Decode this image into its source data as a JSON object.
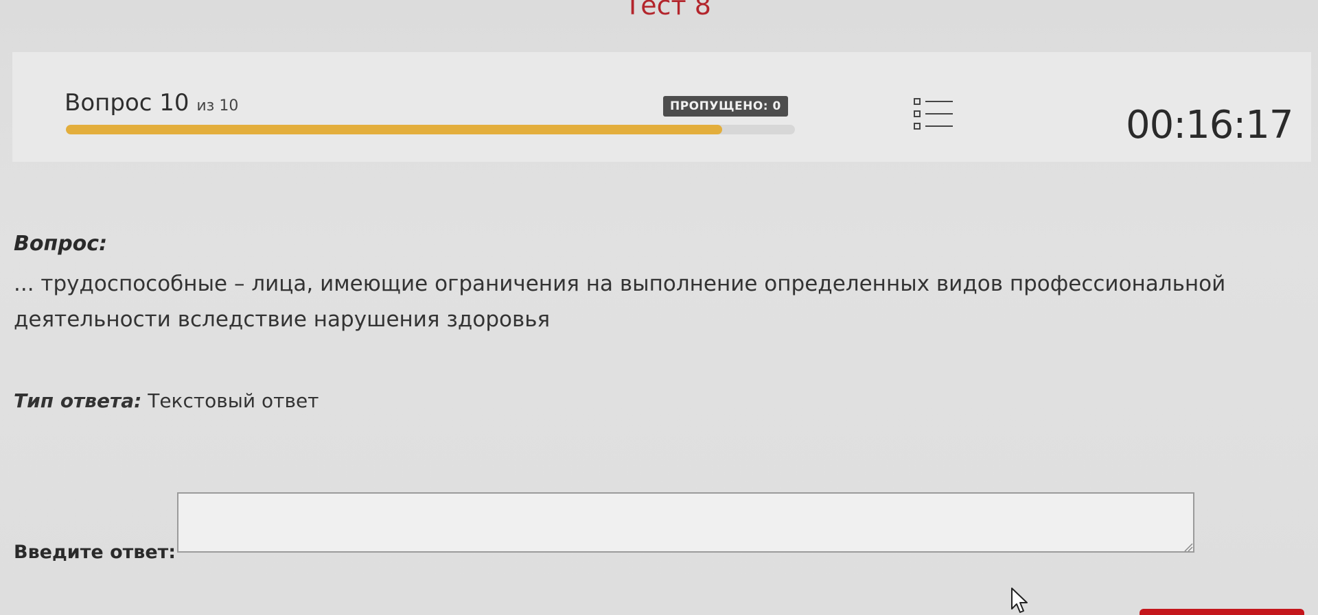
{
  "page": {
    "title": "Тест 8"
  },
  "header": {
    "question_word": "Вопрос",
    "current": "10",
    "of_text": "из 10",
    "progress_percent": 90,
    "skipped_label": "ПРОПУЩЕНО: 0",
    "list_icon": "list-icon",
    "timer": "00:16:17"
  },
  "question": {
    "label": "Вопрос:",
    "text": "... трудоспособные – лица, имеющие ограничения на выполнение определенных видов профессиональной деятельности вследствие нарушения здоровья"
  },
  "answer": {
    "type_label": "Тип ответа:",
    "type_value": "Текстовый ответ",
    "enter_label": "Введите ответ:",
    "value": ""
  },
  "colors": {
    "title_red": "#b3252c",
    "progress": "#e3ae3c",
    "badge_bg": "#4d4d4d",
    "button_red": "#c4161c"
  }
}
